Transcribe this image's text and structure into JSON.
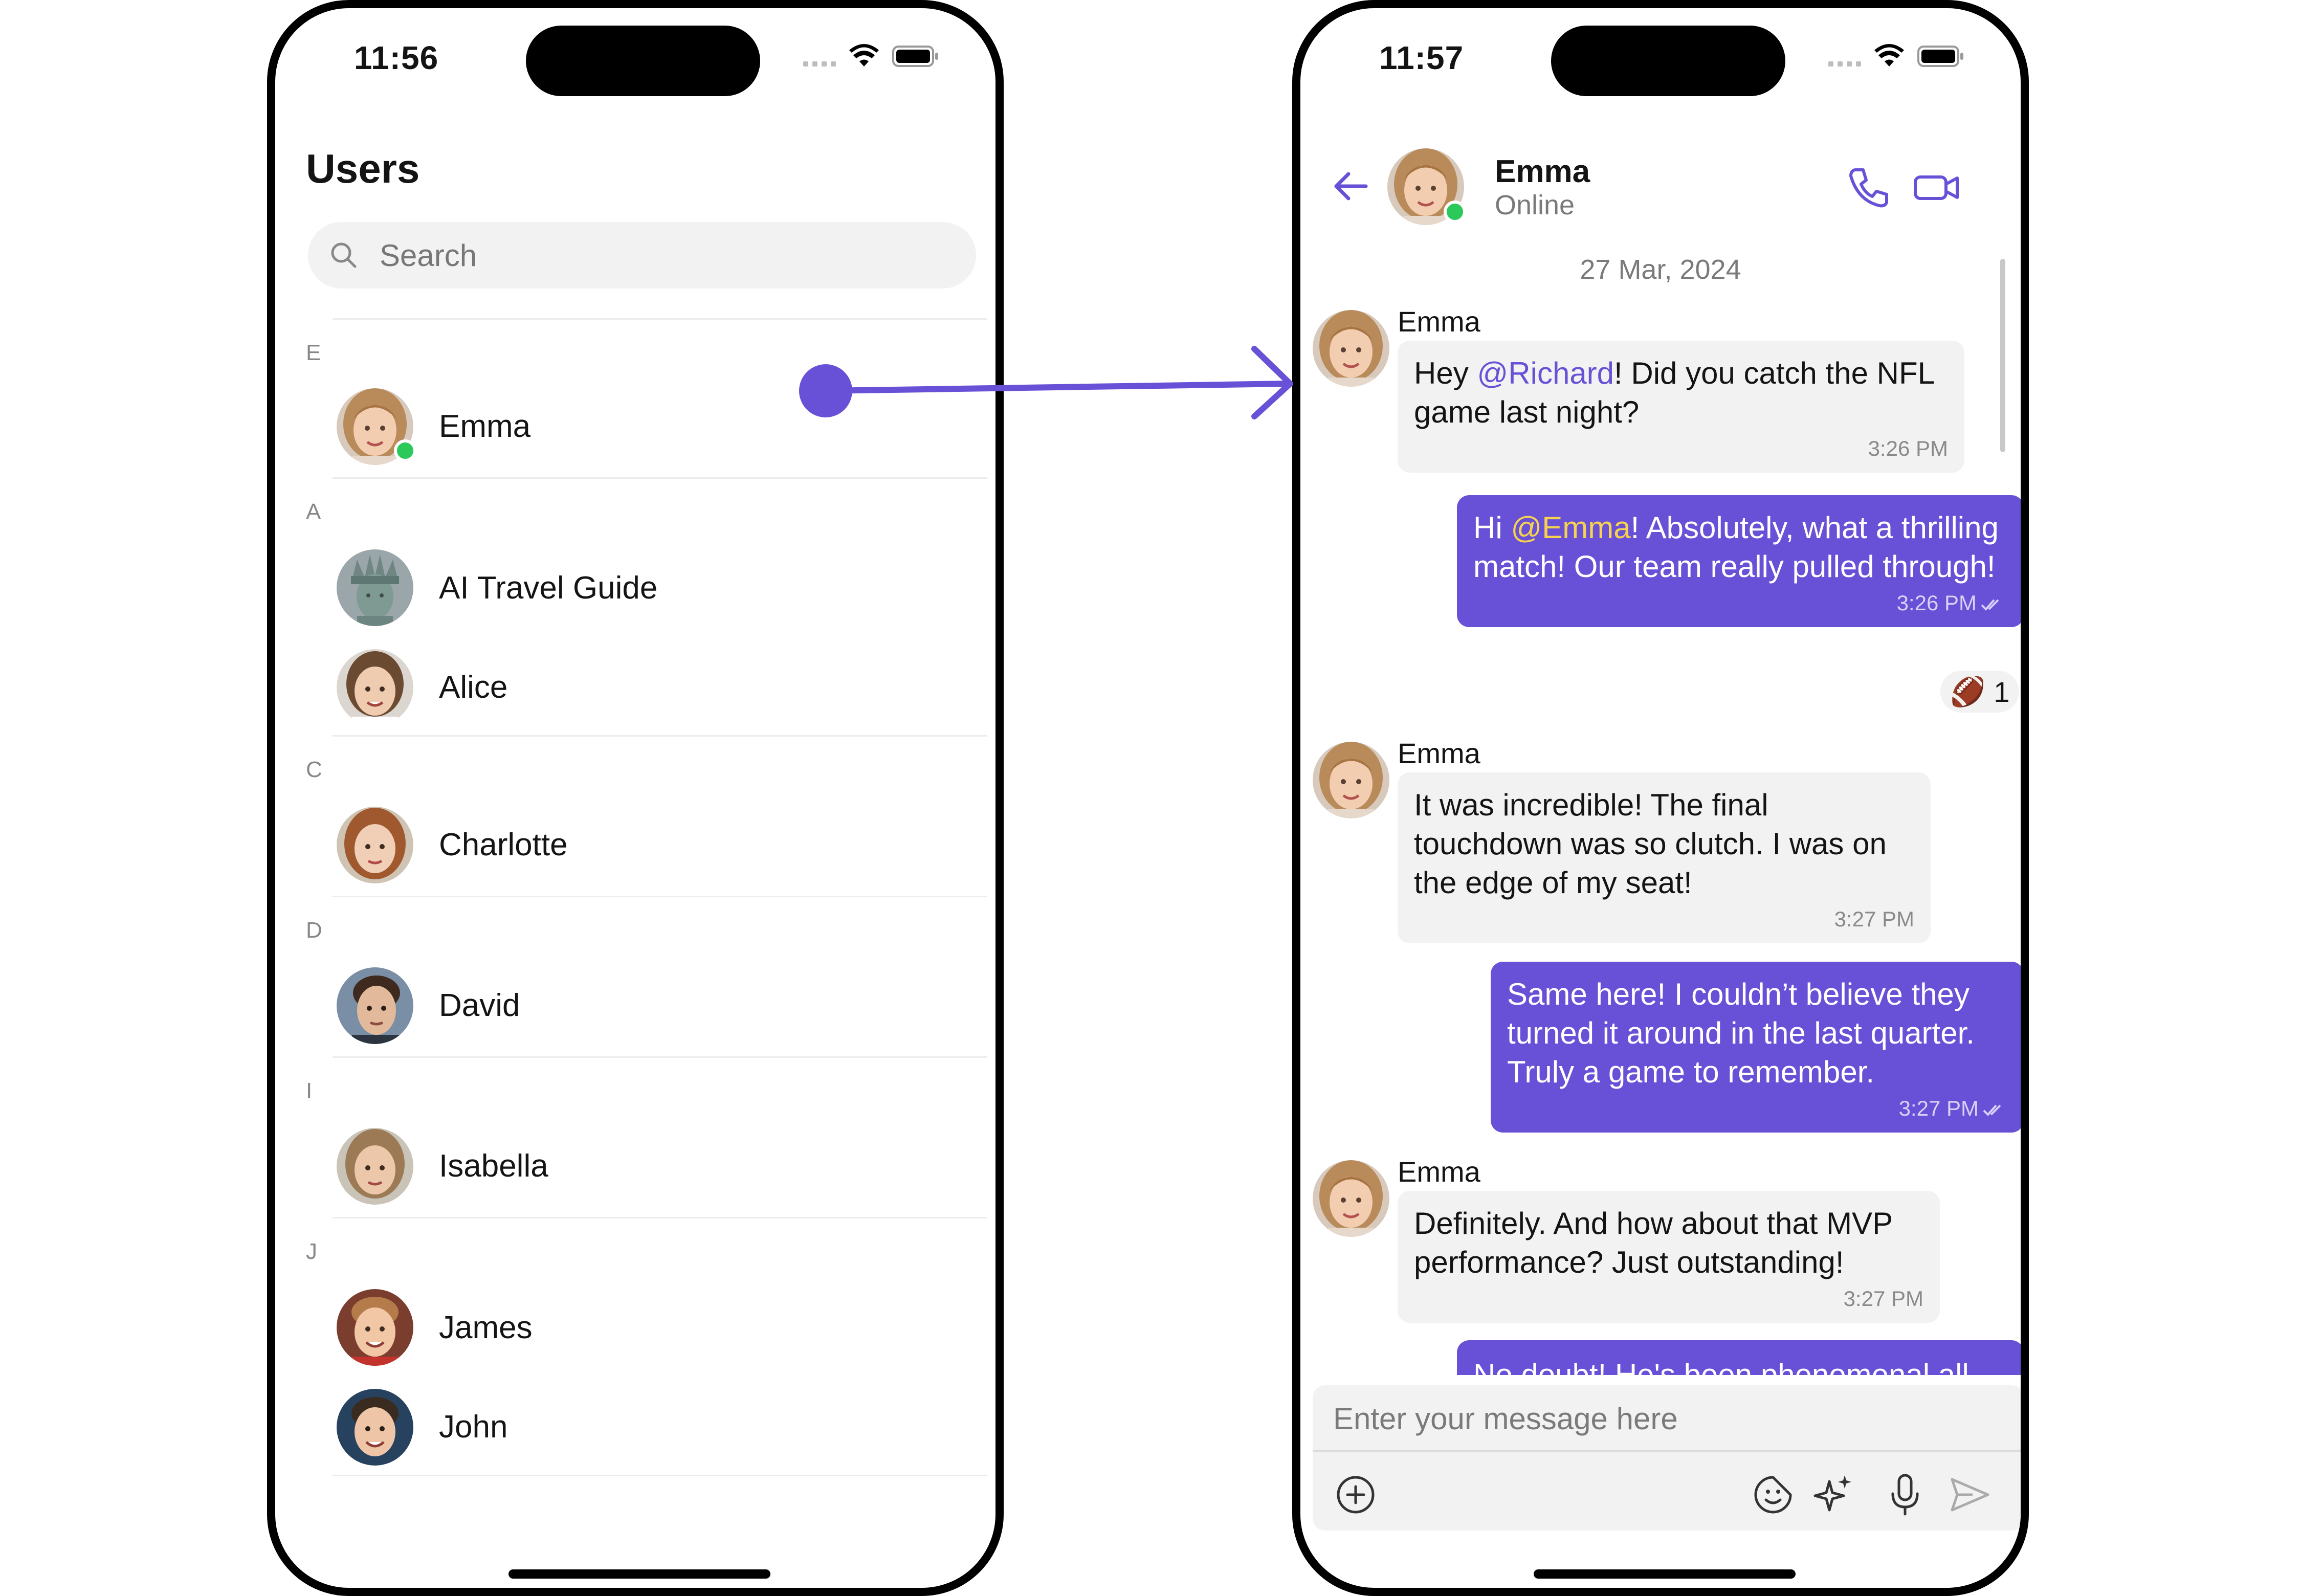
{
  "left_screen": {
    "status_time": "11:56",
    "title": "Users",
    "search": {
      "placeholder": "Search"
    },
    "sections": [
      {
        "letter": "E",
        "users": [
          {
            "name": "Emma",
            "avatar": "emma-avatar",
            "online": true
          }
        ]
      },
      {
        "letter": "A",
        "users": [
          {
            "name": "AI Travel Guide",
            "avatar": "statue-of-liberty-avatar"
          },
          {
            "name": "Alice",
            "avatar": "alice-avatar"
          }
        ]
      },
      {
        "letter": "C",
        "users": [
          {
            "name": "Charlotte",
            "avatar": "charlotte-avatar"
          }
        ]
      },
      {
        "letter": "D",
        "users": [
          {
            "name": "David",
            "avatar": "david-avatar"
          }
        ]
      },
      {
        "letter": "I",
        "users": [
          {
            "name": "Isabella",
            "avatar": "isabella-avatar"
          }
        ]
      },
      {
        "letter": "J",
        "users": [
          {
            "name": "James",
            "avatar": "james-avatar"
          },
          {
            "name": "John",
            "avatar": "john-avatar"
          }
        ]
      }
    ]
  },
  "right_screen": {
    "status_time": "11:57",
    "header": {
      "name": "Emma",
      "status": "Online"
    },
    "date_separator": "27 Mar, 2024",
    "messages": [
      {
        "direction": "in",
        "sender": "Emma",
        "prefix": "Hey ",
        "mention": "@Richard",
        "text": "! Did you catch the NFL game last night?",
        "time": "3:26 PM"
      },
      {
        "direction": "out",
        "prefix": "Hi ",
        "mention": "@Emma",
        "text": "! Absolutely, what a thrilling match! Our team really pulled through!",
        "time": "3:26 PM",
        "reaction": {
          "emoji": "🏈",
          "count": "1"
        }
      },
      {
        "direction": "in",
        "sender": "Emma",
        "text": "It was incredible! The final touchdown was so clutch. I was on the edge of my seat!",
        "time": "3:27 PM"
      },
      {
        "direction": "out",
        "text": "Same here! I couldn’t believe they turned it around in the last quarter. Truly a game to remember.",
        "time": "3:27 PM"
      },
      {
        "direction": "in",
        "sender": "Emma",
        "text": "Definitely. And how about that MVP performance? Just outstanding!",
        "time": "3:27 PM"
      },
      {
        "direction": "out",
        "text": "No doubt! He's been phenomenal all",
        "time": ""
      }
    ],
    "composer": {
      "placeholder": "Enter your message here"
    }
  },
  "colors": {
    "accent": "#6851d6",
    "online": "#2bc85a",
    "mention_outgoing": "#f6d34e",
    "incoming_bubble": "#f2f2f2"
  },
  "icons": [
    "wifi-icon",
    "battery-icon",
    "search-icon",
    "back-arrow-icon",
    "phone-icon",
    "video-icon",
    "double-check-icon",
    "add-icon",
    "sticker-icon",
    "ai-sparkle-icon",
    "microphone-icon",
    "send-icon"
  ]
}
